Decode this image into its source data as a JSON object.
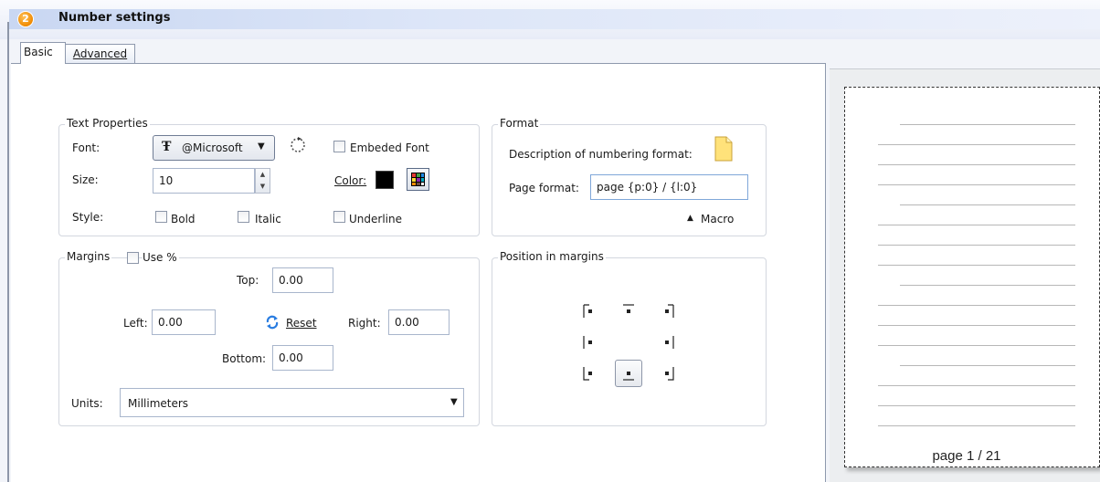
{
  "header": {
    "step": "2",
    "title": "Number settings"
  },
  "tabs": [
    {
      "label": "Basic"
    },
    {
      "label": "Advanced"
    }
  ],
  "text_properties": {
    "legend": "Text Properties",
    "font_label": "Font:",
    "font_value": "@Microsoft",
    "embeded_label": "Embeded Font",
    "size_label": "Size:",
    "size_value": "10",
    "color_label": "Color:",
    "color_value": "#000000",
    "style_label": "Style:",
    "bold_label": "Bold",
    "italic_label": "Italic",
    "underline_label": "Underline"
  },
  "format": {
    "legend": "Format",
    "description_label": "Description of numbering format:",
    "page_format_label": "Page format:",
    "page_format_value": "page {p:0} / {l:0}",
    "macro_label": "Macro"
  },
  "margins": {
    "legend": "Margins",
    "use_percent_label": "Use %",
    "top_label": "Top:",
    "top_value": "0.00",
    "left_label": "Left:",
    "left_value": "0.00",
    "reset_label": "Reset",
    "right_label": "Right:",
    "right_value": "0.00",
    "bottom_label": "Bottom:",
    "bottom_value": "0.00",
    "units_label": "Units:",
    "units_value": "Millimeters"
  },
  "position": {
    "legend": "Position in margins",
    "selected": "bottom-center"
  },
  "preview": {
    "page_label": "page 1 / 21"
  },
  "colors": {
    "accent": "#f08a00",
    "header_bar": "#c9d7f2",
    "border": "#d3d7df"
  }
}
